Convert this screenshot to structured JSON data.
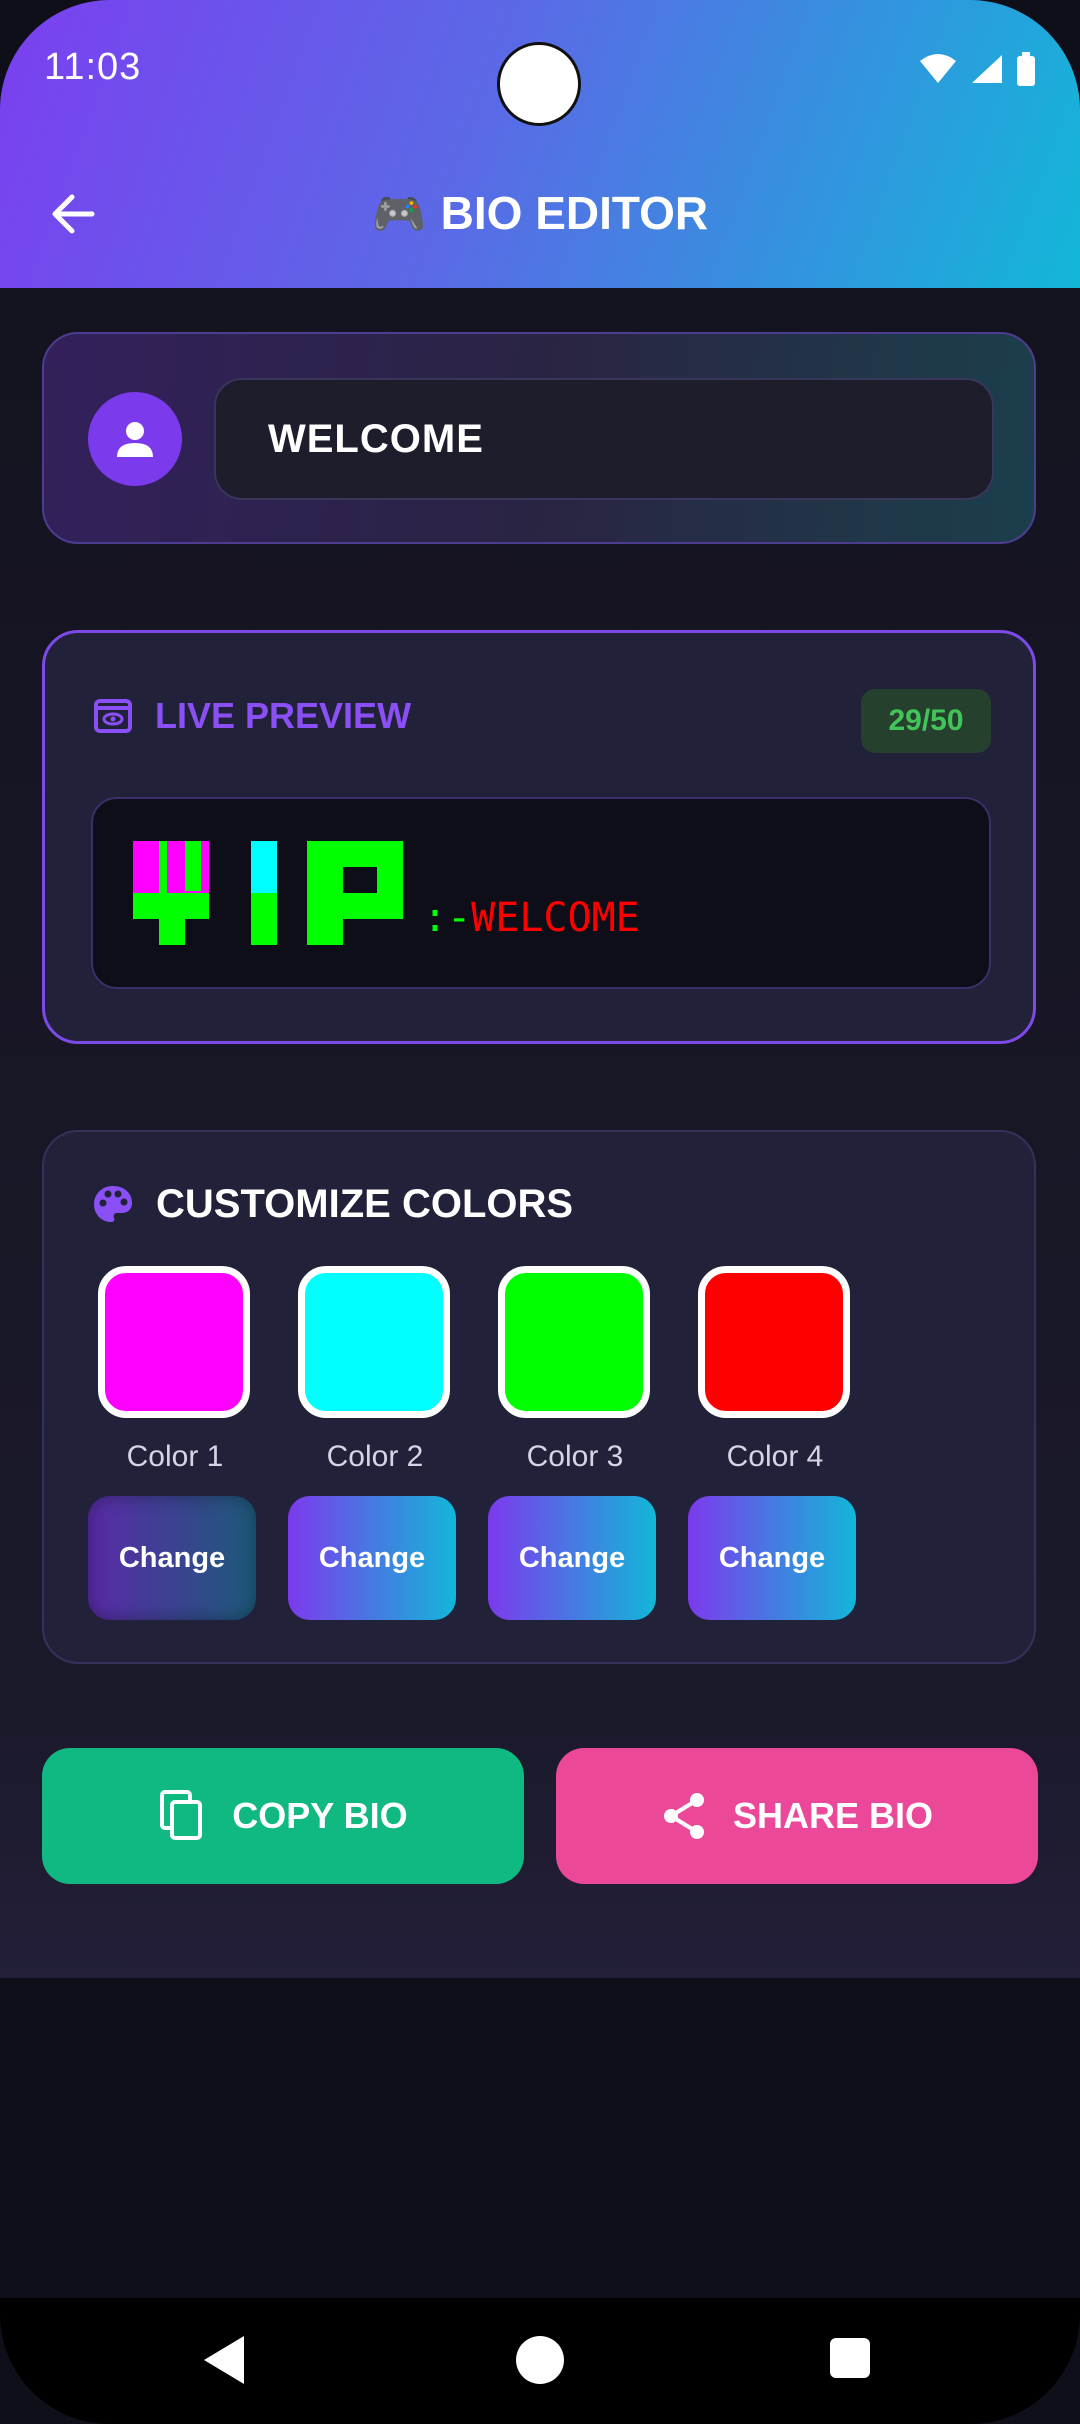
{
  "status_bar": {
    "time": "11:03"
  },
  "app_bar": {
    "title_emoji": "🎮",
    "title": "BIO EDITOR"
  },
  "name_card": {
    "name_value": "WELCOME"
  },
  "preview": {
    "heading": "LIVE PREVIEW",
    "counter": "29/50",
    "art_text": "VIP",
    "separator": ":-",
    "word": "WELCOME",
    "separator_color": "#00ff00",
    "word_color": "#ff0000"
  },
  "colors": {
    "heading": "CUSTOMIZE COLORS",
    "items": [
      {
        "label": "Color 1",
        "color": "#ff00ff",
        "button": "Change"
      },
      {
        "label": "Color 2",
        "color": "#00ffff",
        "button": "Change"
      },
      {
        "label": "Color 3",
        "color": "#00ff00",
        "button": "Change"
      },
      {
        "label": "Color 4",
        "color": "#ff0000",
        "button": "Change"
      }
    ]
  },
  "actions": {
    "copy_label": "COPY BIO",
    "share_label": "SHARE BIO"
  },
  "theme": {
    "header_gradient_start": "#7b3ff0",
    "header_gradient_end": "#12b7d8",
    "accent": "#7c3aed",
    "copy_color": "#10b981",
    "share_color": "#ec4899"
  }
}
